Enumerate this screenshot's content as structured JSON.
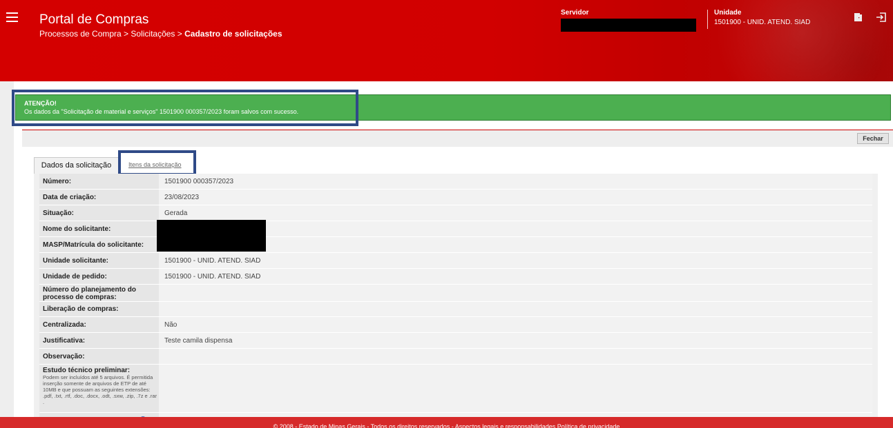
{
  "header": {
    "app_title": "Portal de Compras",
    "breadcrumb_path": "Processos de Compra > Solicitações > ",
    "breadcrumb_current": "Cadastro de solicitações",
    "servidor_label": "Servidor",
    "unidade_label": "Unidade",
    "unidade_value": "1501900 - UNID. ATEND. SIAD"
  },
  "alert": {
    "title": "ATENÇÃO!",
    "message": "Os dados da \"Solicitação de material e serviços\" 1501900 000357/2023 foram salvos com sucesso."
  },
  "toolbar": {
    "close_label": "Fechar"
  },
  "tabs": {
    "active": "Dados da solicitação",
    "other": "Itens da solicitação"
  },
  "form": {
    "numero": {
      "label": "Número:",
      "value": "1501900 000357/2023"
    },
    "data_criacao": {
      "label": "Data de criação:",
      "value": "23/08/2023"
    },
    "situacao": {
      "label": "Situação:",
      "value": "Gerada"
    },
    "nome_solicitante": {
      "label": "Nome do solicitante:",
      "value": ""
    },
    "masp": {
      "label": "MASP/Matrícula do solicitante:",
      "value": ""
    },
    "unidade_solicitante": {
      "label": "Unidade solicitante:",
      "value": "1501900 - UNID. ATEND. SIAD"
    },
    "unidade_pedido": {
      "label": "Unidade de pedido:",
      "value": "1501900 - UNID. ATEND. SIAD"
    },
    "numero_planejamento": {
      "label": "Número do planejamento do processo de compras:",
      "value": ""
    },
    "liberacao": {
      "label": "Liberação de compras:",
      "value": ""
    },
    "centralizada": {
      "label": "Centralizada:",
      "value": "Não"
    },
    "justificativa": {
      "label": "Justificativa:",
      "value": "Teste camila dispensa"
    },
    "observacao": {
      "label": "Observação:",
      "value": ""
    },
    "etp": {
      "label": "Estudo técnico preliminar:",
      "help": "Podem ser incluídos até 5 arquivos. É permitida inserção somente de arquivos de ETP de até 10MB e que possuam as seguintes extensões: .pdf, .txt, .rtf, .doc, .docx, .odt, .sxw, .zip, .7z e .rar ."
    }
  },
  "footer": {
    "text": "© 2008 - Estado de Minas Gerais - Todos os direitos reservados - Aspectos legais e responsabilidades Política de privacidade"
  }
}
